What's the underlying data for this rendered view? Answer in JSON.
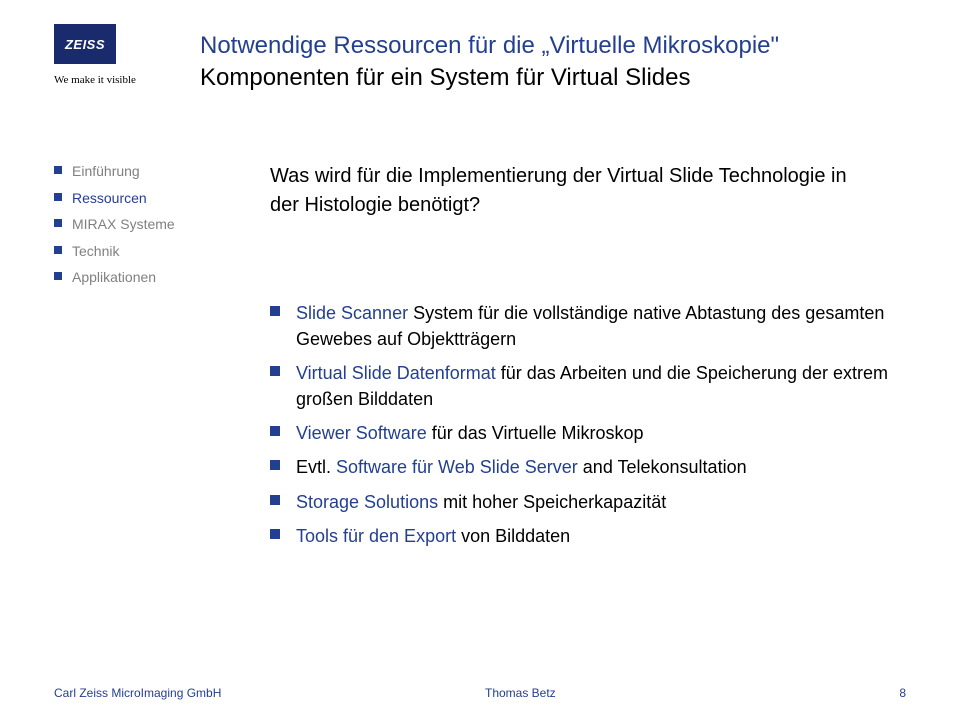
{
  "logo": {
    "brand": "ZEISS",
    "tagline": "We make it visible"
  },
  "header": {
    "title": "Notwendige Ressourcen für die „Virtuelle Mikroskopie\"",
    "subtitle": "Komponenten für ein System für Virtual Slides"
  },
  "nav": {
    "items": [
      {
        "label": "Einführung",
        "cls": "dim"
      },
      {
        "label": "Ressourcen",
        "cls": "active"
      },
      {
        "label": "MIRAX Systeme",
        "cls": "dim"
      },
      {
        "label": "Technik",
        "cls": "dim"
      },
      {
        "label": "Applikationen",
        "cls": "dim"
      }
    ]
  },
  "lead": "Was wird für die Implementierung der Virtual Slide Technologie in der Histologie benötigt?",
  "body": {
    "items": [
      {
        "accent": "Slide Scanner",
        "rest": " System für die vollständige native Abtastung des gesamten Gewebes auf Objektträgern"
      },
      {
        "accent": "Virtual Slide Datenformat",
        "rest": " für das Arbeiten und die Speicherung der extrem großen Bilddaten"
      },
      {
        "accent": "Viewer Software",
        "rest": " für das Virtuelle Mikroskop"
      },
      {
        "accent": "",
        "rest": "Evtl. ",
        "accent2": "Software für Web Slide Server",
        "rest2": " and Telekonsultation"
      },
      {
        "accent": "Storage Solutions",
        "rest": " mit hoher Speicherkapazität"
      },
      {
        "accent": "Tools für den Export",
        "rest": " von Bilddaten"
      }
    ]
  },
  "footer": {
    "left": "Carl Zeiss MicroImaging GmbH",
    "center": "Thomas Betz",
    "right": "8"
  }
}
